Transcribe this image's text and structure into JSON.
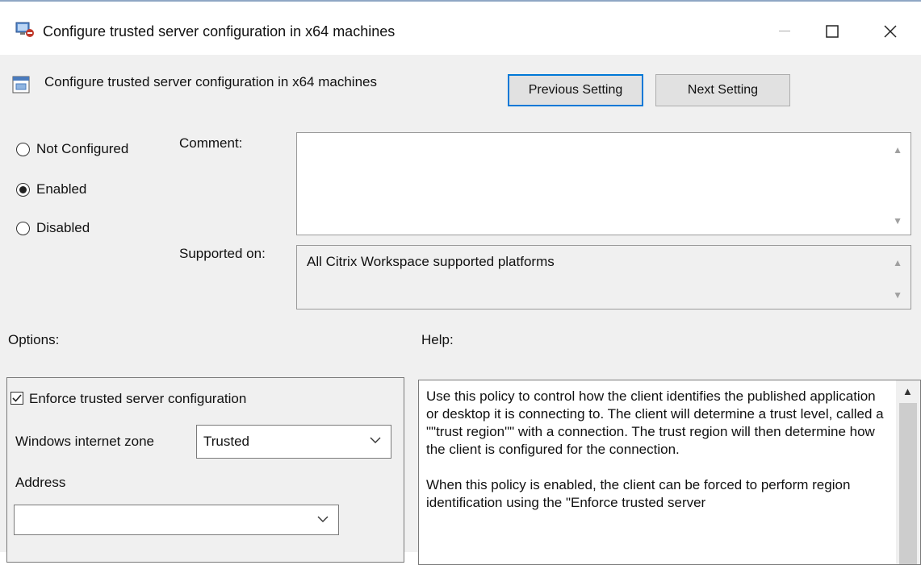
{
  "window": {
    "title": "Configure trusted server configuration in x64 machines",
    "controls": {
      "minimize": "—",
      "maximize": "☐",
      "close": "✕"
    }
  },
  "header": {
    "setting_title": "Configure trusted server configuration in x64 machines",
    "previous_label": "Previous Setting",
    "next_label": "Next Setting"
  },
  "state": {
    "options": [
      {
        "label": "Not Configured",
        "selected": false
      },
      {
        "label": "Enabled",
        "selected": true
      },
      {
        "label": "Disabled",
        "selected": false
      }
    ]
  },
  "comment": {
    "label": "Comment:",
    "value": ""
  },
  "supported": {
    "label": "Supported on:",
    "value": "All Citrix Workspace supported platforms"
  },
  "options_panel": {
    "heading": "Options:",
    "enforce_label": "Enforce trusted server configuration",
    "enforce_checked": true,
    "zone_label": "Windows internet zone",
    "zone_value": "Trusted",
    "address_label": "Address",
    "address_value": ""
  },
  "help_panel": {
    "heading": "Help:",
    "paragraphs": [
      "Use this policy to control how the client identifies the published application or desktop it is connecting to.  The client will determine a trust level, called a \"\"trust region\"\" with a connection.  The trust region will then determine how the client is configured for the connection.",
      "When this policy is enabled, the client can be forced to perform region identification using the \"Enforce trusted server"
    ]
  }
}
